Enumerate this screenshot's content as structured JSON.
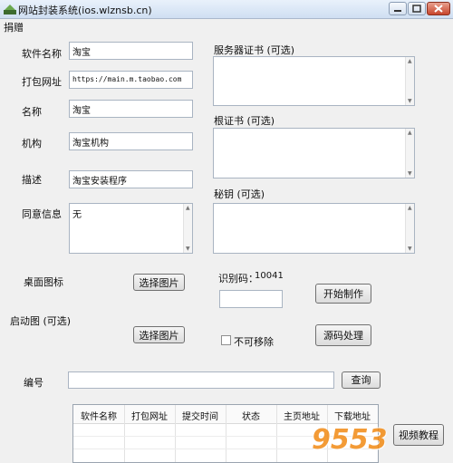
{
  "window": {
    "title": "网站封装系统(ios.wlznsb.cn)"
  },
  "menu": {
    "donate": "捐赠"
  },
  "form": {
    "software_name_label": "软件名称",
    "software_name_value": "淘宝",
    "pack_url_label": "打包网址",
    "pack_url_value": "https://main.m.taobao.com",
    "name_label": "名称",
    "name_value": "淘宝",
    "org_label": "机构",
    "org_value": "淘宝机构",
    "desc_label": "描述",
    "desc_value": "淘宝安装程序",
    "consent_label": "同意信息",
    "consent_value": "无",
    "desktop_icon_label": "桌面图标",
    "launch_image_label": "启动图 (可选)",
    "select_image_btn": "选择图片",
    "select_image_btn2": "选择图片"
  },
  "right": {
    "server_cert_label": "服务器证书 (可选)",
    "root_cert_label": "根证书 (可选)",
    "secret_key_label": "秘钥 (可选)",
    "id_code_label": "识别码：",
    "id_code_value": "10041",
    "start_build_btn": "开始制作",
    "non_removable_label": "不可移除",
    "source_process_btn": "源码处理"
  },
  "search": {
    "number_label": "编号",
    "query_btn": "查询"
  },
  "table": {
    "columns": [
      "软件名称",
      "打包网址",
      "提交时间",
      "状态",
      "主页地址",
      "下载地址"
    ]
  },
  "video_btn": "视频教程",
  "watermark_text": "9553",
  "colors": {
    "titlebar": "#cfdff2",
    "watermark": "#f28a14"
  }
}
